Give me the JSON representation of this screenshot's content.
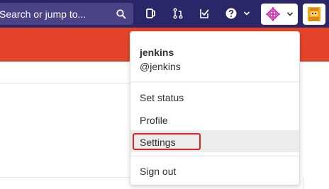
{
  "header": {
    "search_placeholder": "Search or jump to...",
    "icons": [
      "search-icon",
      "todos-icon",
      "merge-requests-icon",
      "issues-icon",
      "help-icon",
      "chevron-down-icon",
      "project-logo",
      "user-avatar"
    ]
  },
  "user_menu": {
    "username": "jenkins",
    "handle": "@jenkins",
    "items": [
      {
        "label": "Set status"
      },
      {
        "label": "Profile"
      },
      {
        "label": "Settings",
        "highlighted": true
      },
      {
        "label": "Sign out"
      }
    ]
  },
  "colors": {
    "topbar": "#2b2668",
    "search": "#4a4486",
    "accent_bar": "#e24329",
    "highlight_border": "#e0202a"
  }
}
